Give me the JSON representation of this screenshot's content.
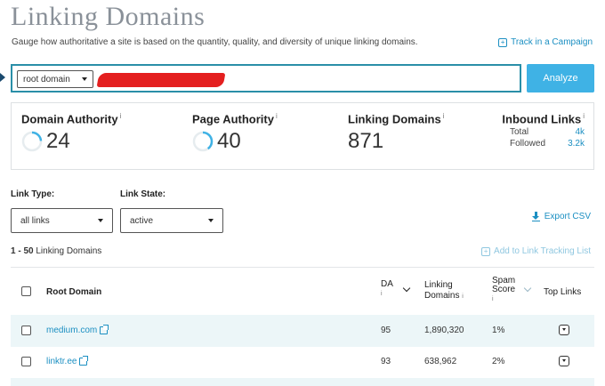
{
  "header": {
    "title": "Linking Domains",
    "subtitle": "Gauge how authoritative a site is based on the quantity, quality, and diversity of unique linking domains.",
    "track_link": "Track in a Campaign"
  },
  "search": {
    "scope_select": "root domain",
    "analyze_label": "Analyze"
  },
  "metrics": {
    "domain_authority": {
      "label": "Domain Authority",
      "value": "24",
      "fraction": 0.24
    },
    "page_authority": {
      "label": "Page Authority",
      "value": "40",
      "fraction": 0.4
    },
    "linking_domains": {
      "label": "Linking Domains",
      "value": "871"
    },
    "inbound_links": {
      "label": "Inbound Links",
      "total_label": "Total",
      "total_value": "4k",
      "followed_label": "Followed",
      "followed_value": "3.2k"
    },
    "info_marker": "i",
    "ring_color": "#3fb2e5"
  },
  "filters": {
    "link_type_label": "Link Type:",
    "link_type_value": "all links",
    "link_state_label": "Link State:",
    "link_state_value": "active",
    "export_label": "Export CSV"
  },
  "results": {
    "range": "1 - 50",
    "range_suffix": " Linking Domains",
    "add_tracking": "Add to Link Tracking List"
  },
  "table": {
    "headers": {
      "root_domain": "Root Domain",
      "da": "DA",
      "linking_domains_1": "Linking",
      "linking_domains_2": "Domains",
      "spam_1": "Spam",
      "spam_2": "Score",
      "top_links": "Top Links"
    },
    "rows": [
      {
        "domain": "medium.com",
        "da": "95",
        "linking_domains": "1,890,320",
        "spam": "1%"
      },
      {
        "domain": "linktr.ee",
        "da": "93",
        "linking_domains": "638,962",
        "spam": "2%"
      }
    ]
  }
}
